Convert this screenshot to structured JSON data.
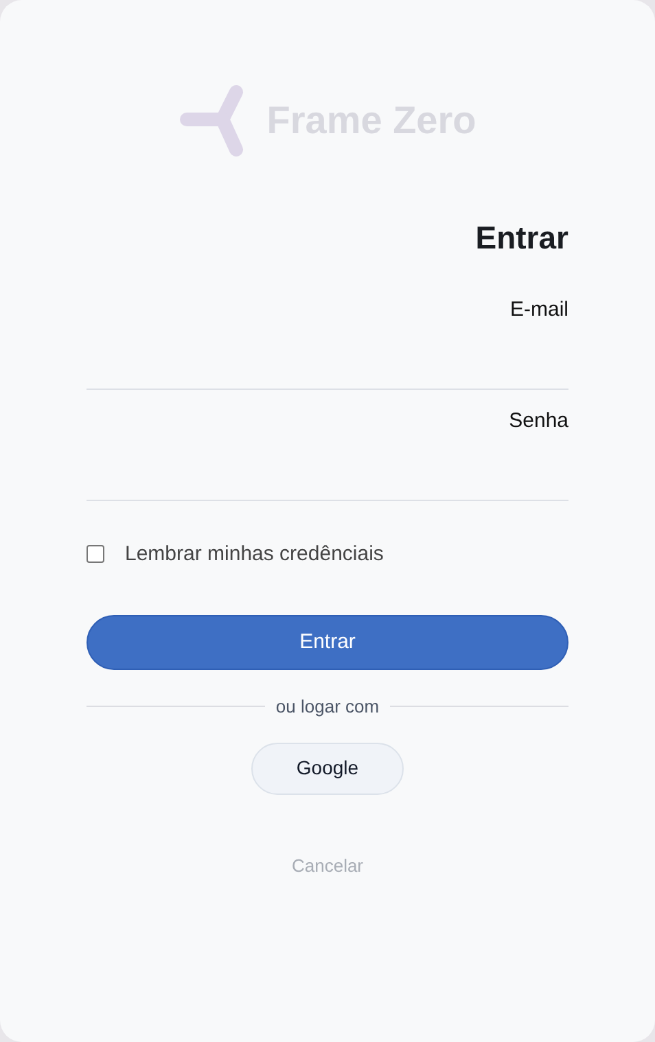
{
  "logo": {
    "name": "Frame Zero"
  },
  "heading": "Entrar",
  "fields": [
    {
      "label": "E-mail"
    },
    {
      "label": "Senha"
    }
  ],
  "remember": {
    "label": "Lembrar minhas credênciais",
    "checked": false
  },
  "submit": "Entrar",
  "divider": "ou logar com",
  "providers": [
    "Google"
  ],
  "cancel": "Cancelar"
}
